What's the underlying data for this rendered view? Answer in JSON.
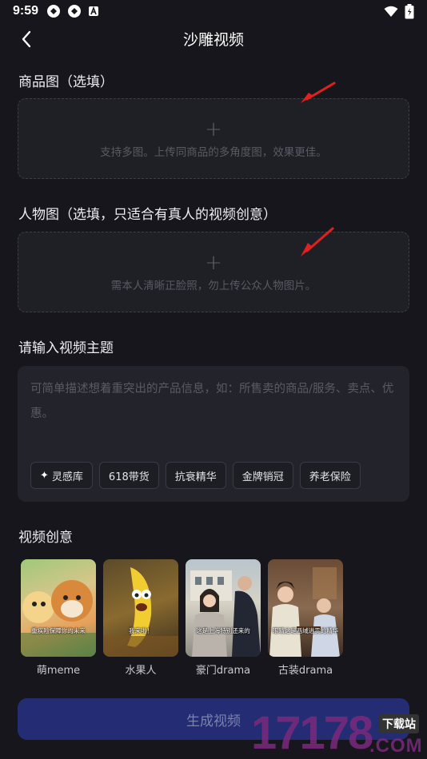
{
  "status": {
    "time": "9:59"
  },
  "header": {
    "title": "沙雕视频"
  },
  "product_image": {
    "title": "商品图（选填）",
    "hint": "支持多图。上传同商品的多角度图，效果更佳。",
    "plus": "+"
  },
  "person_image": {
    "title": "人物图（选填，只适合有真人的视频创意）",
    "hint": "需本人清晰正脸照，勿上传公众人物图片。",
    "plus": "+"
  },
  "topic": {
    "title": "请输入视频主题",
    "placeholder": "可简单描述想着重突出的产品信息，如：所售卖的商品/服务、卖点、优惠。",
    "tags": [
      {
        "label": "灵感库",
        "icon": "sparkle-icon"
      },
      {
        "label": "618带货"
      },
      {
        "label": "抗衰精华"
      },
      {
        "label": "金牌销冠"
      },
      {
        "label": "养老保险"
      }
    ]
  },
  "ideas": {
    "title": "视频创意",
    "items": [
      {
        "label": "萌meme",
        "caption": "重疾险保障你的未来"
      },
      {
        "label": "水果人",
        "caption": "我来啦！"
      },
      {
        "label": "豪门drama",
        "caption": "这是上海特别还来的"
      },
      {
        "label": "古装drama",
        "caption": "眼睛这是西域进贡的精华"
      }
    ]
  },
  "generate_button": {
    "label": "生成视频"
  },
  "watermark": {
    "number": "17178",
    "top": "下载站",
    "com": ".COM"
  },
  "colors": {
    "background": "#16161c",
    "button": "#242d74",
    "arrow": "#e0211f"
  }
}
